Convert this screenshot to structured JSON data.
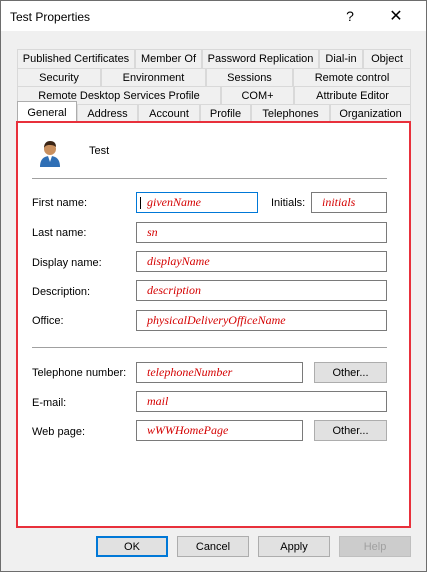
{
  "window": {
    "title": "Test Properties",
    "help_glyph": "?",
    "close_glyph": "✕"
  },
  "tabs": {
    "row1": [
      "Published Certificates",
      "Member Of",
      "Password Replication",
      "Dial-in",
      "Object"
    ],
    "row2": [
      "Security",
      "Environment",
      "Sessions",
      "Remote control"
    ],
    "row3": [
      "Remote Desktop Services Profile",
      "COM+",
      "Attribute Editor"
    ],
    "row4": [
      "General",
      "Address",
      "Account",
      "Profile",
      "Telephones",
      "Organization"
    ],
    "active": "General"
  },
  "general": {
    "user_name": "Test",
    "first_name": {
      "label": "First name:",
      "value": "givenName"
    },
    "initials": {
      "label": "Initials:",
      "value": "initials"
    },
    "last_name": {
      "label": "Last name:",
      "value": "sn"
    },
    "display_name": {
      "label": "Display name:",
      "value": "displayName"
    },
    "description": {
      "label": "Description:",
      "value": "description"
    },
    "office": {
      "label": "Office:",
      "value": "physicalDeliveryOfficeName"
    },
    "telephone": {
      "label": "Telephone number:",
      "value": "telephoneNumber",
      "other_label": "Other..."
    },
    "email": {
      "label": "E-mail:",
      "value": "mail"
    },
    "web_page": {
      "label": "Web page:",
      "value": "wWWHomePage",
      "other_label": "Other..."
    }
  },
  "buttons": {
    "ok": "OK",
    "cancel": "Cancel",
    "apply": "Apply",
    "help": "Help"
  },
  "colors": {
    "annotation_red": "#e8303b",
    "value_red": "#d40000",
    "focus_blue": "#0078d7"
  }
}
